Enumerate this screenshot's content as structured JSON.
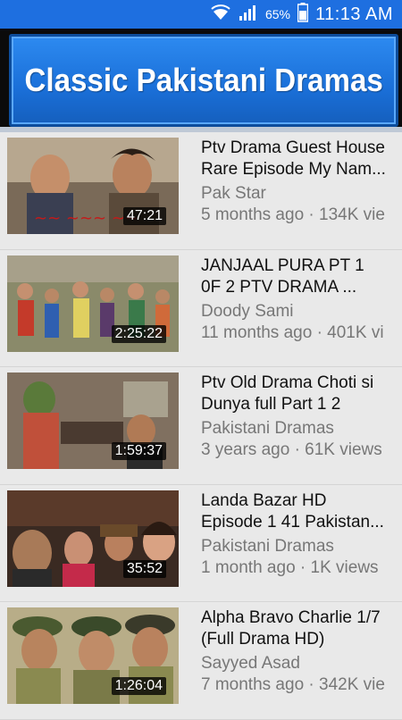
{
  "status_bar": {
    "battery_percent": "65%",
    "time": "11:13 AM",
    "icons": [
      "wifi-icon",
      "signal-icon",
      "battery-icon"
    ]
  },
  "header": {
    "title": "Classic Pakistani Dramas"
  },
  "videos": [
    {
      "title_line1": "Ptv Drama Guest House",
      "title_line2": "Rare Episode My Nam...",
      "channel": "Pak Star",
      "stats": "5 months ago · 134K vie",
      "duration": "47:21"
    },
    {
      "title_line1": "JANJAAL PURA   PT 1",
      "title_line2": "0F 2  PTV DRAMA ...",
      "channel": "Doody Sami",
      "stats": "11 months ago · 401K vi",
      "duration": "2:25:22"
    },
    {
      "title_line1": "Ptv Old Drama Choti si",
      "title_line2": "Dunya  full Part 1 2",
      "channel": "Pakistani Dramas",
      "stats": "3 years ago · 61K views",
      "duration": "1:59:37"
    },
    {
      "title_line1": "Landa Bazar HD",
      "title_line2": "Episode 1 41 Pakistan...",
      "channel": "Pakistani Dramas",
      "stats": "1 month ago · 1K views",
      "duration": "35:52"
    },
    {
      "title_line1": "Alpha Bravo Charlie 1/7",
      "title_line2": "(Full Drama HD)",
      "channel": "Sayyed Asad",
      "stats": "7 months ago · 342K vie",
      "duration": "1:26:04"
    }
  ]
}
